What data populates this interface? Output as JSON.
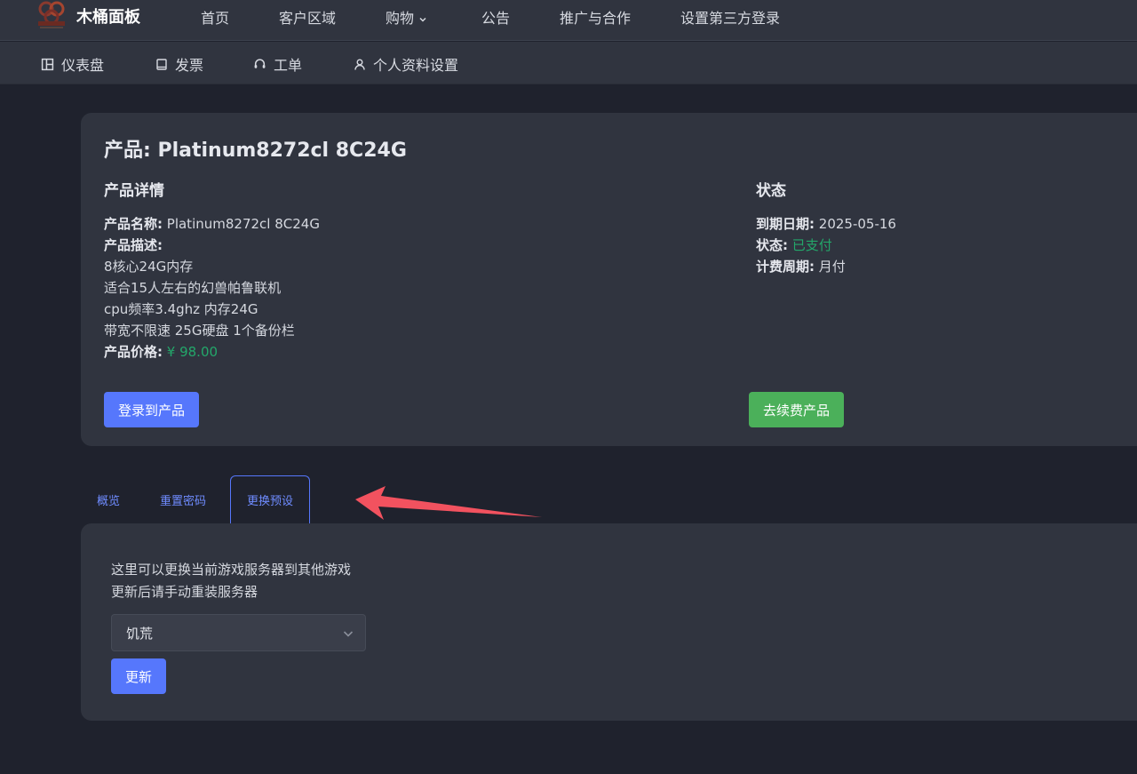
{
  "brand": {
    "name": "木桶面板"
  },
  "nav": {
    "home": "首页",
    "client_area": "客户区域",
    "shop": "购物",
    "announcements": "公告",
    "affiliate": "推广与合作",
    "third_party_login": "设置第三方登录"
  },
  "subnav": {
    "dashboard": "仪表盘",
    "invoices": "发票",
    "tickets": "工单",
    "profile": "个人资料设置"
  },
  "product": {
    "title": "产品: Platinum8272cl 8C24G",
    "details_heading": "产品详情",
    "name_label": "产品名称:",
    "name_value": "Platinum8272cl 8C24G",
    "desc_label": "产品描述:",
    "desc_line1": "8核心24G内存",
    "desc_line2": "适合15人左右的幻兽帕鲁联机",
    "desc_line3": "cpu频率3.4ghz 内存24G",
    "desc_line4": "带宽不限速 25G硬盘 1个备份栏",
    "price_label": "产品价格:",
    "price_value": "¥ 98.00",
    "status_heading": "状态",
    "due_label": "到期日期:",
    "due_value": "2025-05-16",
    "status_label": "状态:",
    "status_value": "已支付",
    "billing_label": "计费周期:",
    "billing_value": "月付",
    "login_button": "登录到产品",
    "renew_button": "去续费产品"
  },
  "tabs": {
    "overview": "概览",
    "reset_password": "重置密码",
    "change_preset": "更换预设"
  },
  "preset_panel": {
    "line1": "这里可以更换当前游戏服务器到其他游戏",
    "line2": "更新后请手动重装服务器",
    "selected_game": "饥荒",
    "update_button": "更新"
  },
  "colors": {
    "background": "#1f222d",
    "card": "#30343f",
    "accent_blue": "#5677fc",
    "accent_green": "#4bb05a",
    "status_green": "#23a76a",
    "annotation_arrow": "#f2525f"
  }
}
